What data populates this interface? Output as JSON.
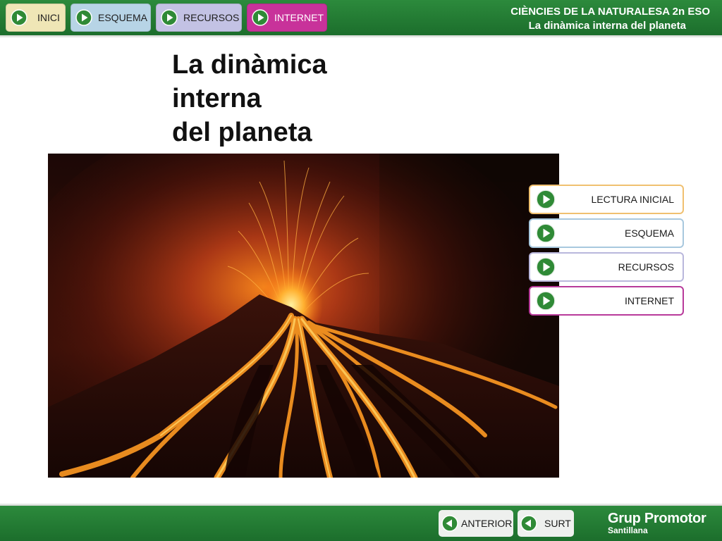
{
  "header": {
    "nav": [
      {
        "label": "INICI",
        "icon": "play-arrow-icon",
        "color": "#efe6b6"
      },
      {
        "label": "ESQUEMA",
        "icon": "play-arrow-icon",
        "color": "#b7d4e6"
      },
      {
        "label": "RECURSOS",
        "icon": "play-arrow-icon",
        "color": "#c3c2e4"
      },
      {
        "label": "INTERNET",
        "icon": "play-arrow-icon",
        "color": "#c8329a"
      }
    ],
    "subject": "CIÈNCIES DE LA NATURALESA 2n ESO",
    "unit": "La dinàmica interna del planeta",
    "bar_color": "#238033"
  },
  "main": {
    "title_lines": [
      "La dinàmica",
      "interna",
      "del planeta"
    ],
    "image": {
      "subject": "erupting volcano with lava flows at night",
      "icon": "volcano-photo"
    }
  },
  "menu": {
    "items": [
      {
        "label": "LECTURA INICIAL",
        "icon": "play-arrow-icon",
        "border": "#f0c070"
      },
      {
        "label": "ESQUEMA",
        "icon": "play-arrow-icon",
        "border": "#a8c8de"
      },
      {
        "label": "RECURSOS",
        "icon": "play-arrow-icon",
        "border": "#b9b7dc"
      },
      {
        "label": "INTERNET",
        "icon": "play-arrow-icon",
        "border": "#b83a9a"
      }
    ]
  },
  "footer": {
    "anterior_label": "ANTERIOR",
    "surt_label": "SURT",
    "brand_line1": "Grup Promotor",
    "brand_line2": "Santillana"
  },
  "colors": {
    "icon_green": "#2f8a36",
    "accent_magenta": "#c8329a"
  }
}
